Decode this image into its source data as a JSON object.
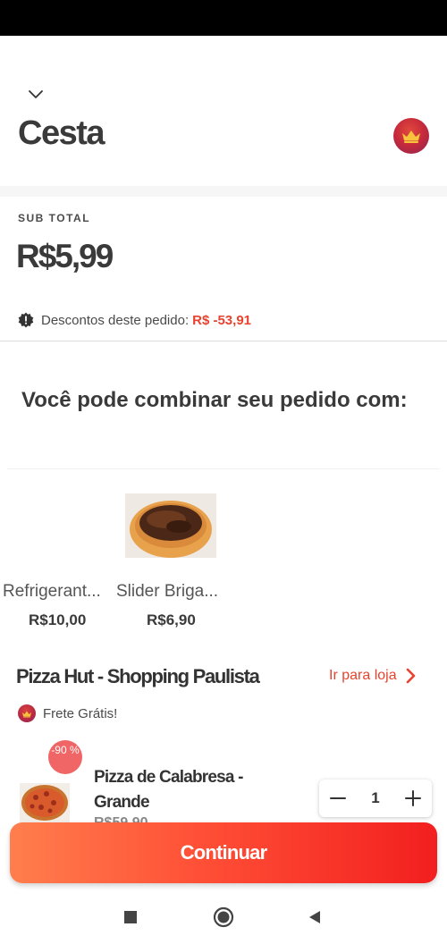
{
  "header": {
    "title": "Cesta",
    "collapse_icon": "chevron-down-icon",
    "brand_icon": "crown-icon"
  },
  "summary": {
    "subtotal_label": "SUB TOTAL",
    "subtotal_value": "R$5,99",
    "discount_label": "Descontos deste pedido:",
    "discount_value": "R$ -53,91"
  },
  "suggestions": {
    "title": "Você pode combinar seu pedido com:",
    "items": [
      {
        "name": "Refrigerant...",
        "price": "R$10,00"
      },
      {
        "name": "Slider Briga...",
        "price": "R$6,90"
      }
    ]
  },
  "store": {
    "name": "Pizza Hut - Shopping Paulista",
    "link_label": "Ir para loja",
    "free_shipping": "Frete Grátis!"
  },
  "cart_item": {
    "discount_badge": "-90 %",
    "name": "Pizza de Calabresa - Grande",
    "price": "R$59,90",
    "quantity": "1"
  },
  "actions": {
    "continue_label": "Continuar"
  },
  "colors": {
    "accent": "#e8432f",
    "button_start": "#ff7e4d",
    "button_end": "#f21f1f",
    "badge": "#f06565"
  }
}
